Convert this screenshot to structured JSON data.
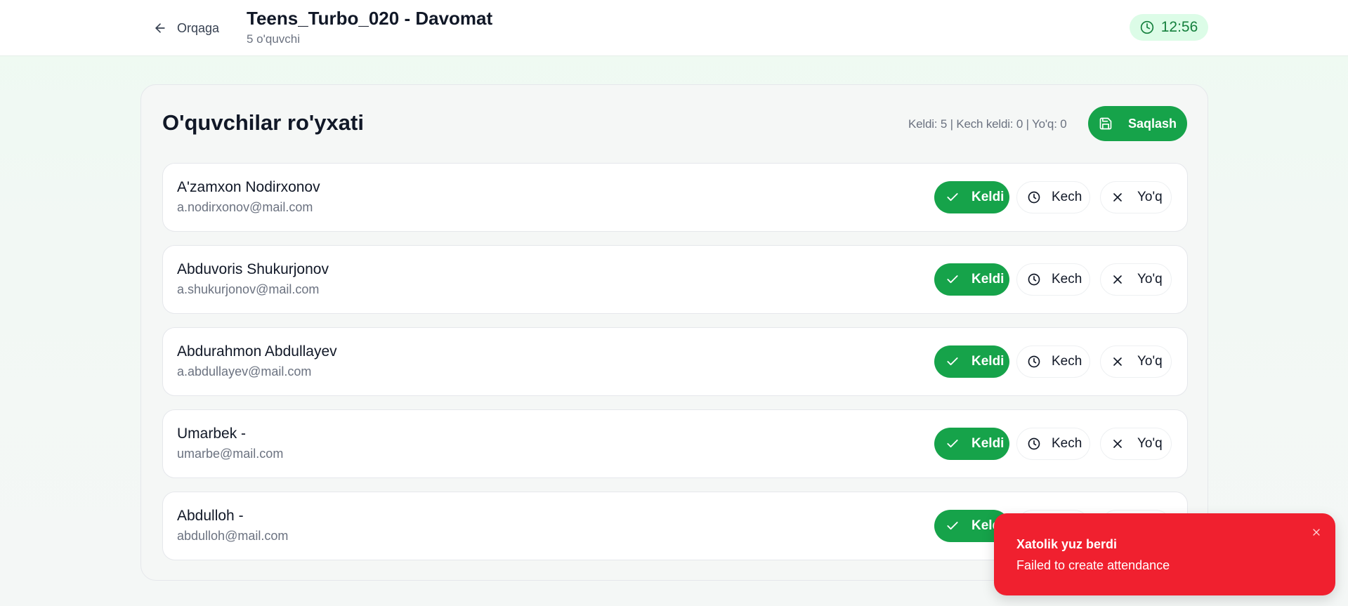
{
  "header": {
    "back_label": "Orqaga",
    "title": "Teens_Turbo_020 - Davomat",
    "subtitle": "5 o'quvchi",
    "clock": "12:56"
  },
  "card": {
    "title": "O'quvchilar ro'yxati",
    "stats": "Keldi: 5 | Kech keldi: 0 | Yo'q: 0",
    "save_label": "Saqlash"
  },
  "status_labels": {
    "present": "Keldi",
    "late": "Kech",
    "absent": "Yo'q"
  },
  "students": [
    {
      "name": "A'zamxon Nodirxonov",
      "email": "a.nodirxonov@mail.com",
      "status": "Keldi"
    },
    {
      "name": "Abduvoris Shukurjonov",
      "email": "a.shukurjonov@mail.com",
      "status": "Keldi"
    },
    {
      "name": "Abdurahmon Abdullayev",
      "email": "a.abdullayev@mail.com",
      "status": "Keldi"
    },
    {
      "name": "Umarbek -",
      "email": "umarbe@mail.com",
      "status": "Keldi"
    },
    {
      "name": "Abdulloh -",
      "email": "abdulloh@mail.com",
      "status": "Keldi"
    }
  ],
  "toast": {
    "title": "Xatolik yuz berdi",
    "message": "Failed to create attendance"
  },
  "colors": {
    "accent": "#16a34a",
    "badge_bg": "#dcfce7",
    "error": "#f0202f"
  },
  "icons": {
    "back": "arrow-left-icon",
    "clock": "clock-icon",
    "save": "save-icon",
    "check": "check-icon",
    "close": "x-icon"
  }
}
